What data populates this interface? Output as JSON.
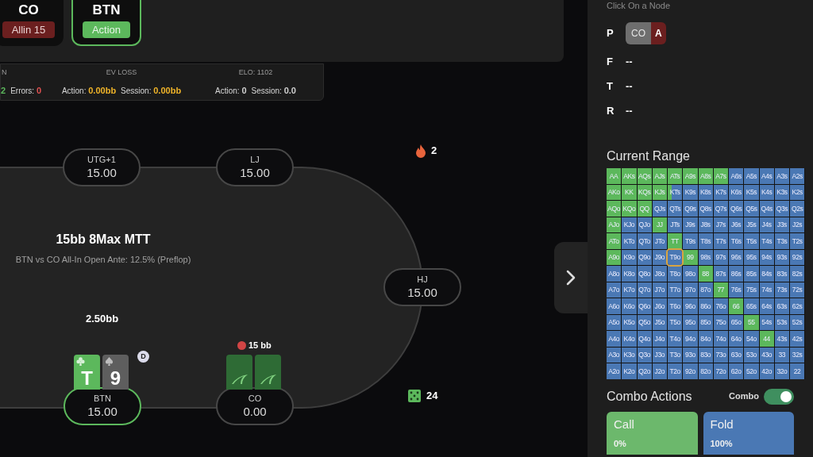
{
  "header_positions": [
    {
      "name": "CO",
      "badge": "Allin 15",
      "kind": "allin",
      "selected": false
    },
    {
      "name": "BTN",
      "badge": "Action",
      "kind": "action",
      "selected": true
    }
  ],
  "stats": [
    {
      "heading": "N",
      "items": [
        {
          "value": "2",
          "color": "#5cb85c"
        },
        {
          "label": "Errors:",
          "value": "0",
          "color": "#e05252"
        }
      ]
    },
    {
      "heading": "EV LOSS",
      "items": [
        {
          "label": "Action:",
          "value": "0.00bb",
          "color": "#f0b429"
        },
        {
          "label": "Session:",
          "value": "0.00bb",
          "color": "#f0b429"
        }
      ]
    },
    {
      "heading": "ELO: 1102",
      "items": [
        {
          "label": "Action:",
          "value": "0",
          "color": "#cfcfcf"
        },
        {
          "label": "Session:",
          "value": "0.0",
          "color": "#cfcfcf"
        }
      ]
    }
  ],
  "table": {
    "title": "15bb 8Max MTT",
    "subtitle": "BTN vs CO All-In Open Ante: 12.5% (Preflop)",
    "seats": [
      {
        "position": "UTG+1",
        "stack": "15.00",
        "active": false
      },
      {
        "position": "LJ",
        "stack": "15.00",
        "active": false
      },
      {
        "position": "HJ",
        "stack": "15.00",
        "active": false
      },
      {
        "position": "BTN",
        "stack": "15.00",
        "active": true,
        "bet": "2.50bb",
        "dealer": "D",
        "cards": [
          {
            "rank": "T",
            "kind": "clubs"
          },
          {
            "rank": "9",
            "kind": "spades"
          }
        ]
      },
      {
        "position": "CO",
        "stack": "0.00",
        "active": false,
        "allin": "15 bb",
        "cards": [
          {
            "kind": "back"
          },
          {
            "kind": "back"
          }
        ]
      }
    ],
    "streak": "2",
    "hands_count": "24"
  },
  "node_panel": {
    "hint": "Click On a Node",
    "streets": [
      {
        "label": "P",
        "actions": [
          {
            "seat": "CO",
            "action": "A"
          }
        ]
      },
      {
        "label": "F",
        "empty": "--"
      },
      {
        "label": "T",
        "empty": "--"
      },
      {
        "label": "R",
        "empty": "--"
      }
    ]
  },
  "range": {
    "title": "Current Range",
    "rows": [
      [
        {
          "hand": "AA",
          "kind": "call",
          "selected": false
        },
        {
          "hand": "AKs",
          "kind": "call",
          "selected": false
        },
        {
          "hand": "AQs",
          "kind": "call",
          "selected": false
        },
        {
          "hand": "AJs",
          "kind": "call",
          "selected": false
        },
        {
          "hand": "ATs",
          "kind": "call",
          "selected": false
        },
        {
          "hand": "A9s",
          "kind": "call",
          "selected": false
        },
        {
          "hand": "A8s",
          "kind": "call",
          "selected": false
        },
        {
          "hand": "A7s",
          "kind": "call",
          "selected": false
        },
        {
          "hand": "A6s",
          "kind": "fold",
          "selected": false
        },
        {
          "hand": "A5s",
          "kind": "fold",
          "selected": false
        },
        {
          "hand": "A4s",
          "kind": "fold",
          "selected": false
        },
        {
          "hand": "A3s",
          "kind": "fold",
          "selected": false
        },
        {
          "hand": "A2s",
          "kind": "fold",
          "selected": false
        }
      ],
      [
        {
          "hand": "AKo",
          "kind": "call",
          "selected": false
        },
        {
          "hand": "KK",
          "kind": "call",
          "selected": false
        },
        {
          "hand": "KQs",
          "kind": "call",
          "selected": false
        },
        {
          "hand": "KJs",
          "kind": "call",
          "selected": false
        },
        {
          "hand": "KTs",
          "kind": "mixed",
          "selected": false
        },
        {
          "hand": "K9s",
          "kind": "fold",
          "selected": false
        },
        {
          "hand": "K8s",
          "kind": "fold",
          "selected": false
        },
        {
          "hand": "K7s",
          "kind": "fold",
          "selected": false
        },
        {
          "hand": "K6s",
          "kind": "fold",
          "selected": false
        },
        {
          "hand": "K5s",
          "kind": "fold",
          "selected": false
        },
        {
          "hand": "K4s",
          "kind": "fold",
          "selected": false
        },
        {
          "hand": "K3s",
          "kind": "fold",
          "selected": false
        },
        {
          "hand": "K2s",
          "kind": "fold",
          "selected": false
        }
      ],
      [
        {
          "hand": "AQo",
          "kind": "call",
          "selected": false
        },
        {
          "hand": "KQo",
          "kind": "call",
          "selected": false
        },
        {
          "hand": "QQ",
          "kind": "call",
          "selected": false
        },
        {
          "hand": "QJs",
          "kind": "fold",
          "selected": false
        },
        {
          "hand": "QTs",
          "kind": "fold",
          "selected": false
        },
        {
          "hand": "Q9s",
          "kind": "fold",
          "selected": false
        },
        {
          "hand": "Q8s",
          "kind": "fold",
          "selected": false
        },
        {
          "hand": "Q7s",
          "kind": "fold",
          "selected": false
        },
        {
          "hand": "Q6s",
          "kind": "fold",
          "selected": false
        },
        {
          "hand": "Q5s",
          "kind": "fold",
          "selected": false
        },
        {
          "hand": "Q4s",
          "kind": "fold",
          "selected": false
        },
        {
          "hand": "Q3s",
          "kind": "fold",
          "selected": false
        },
        {
          "hand": "Q2s",
          "kind": "fold",
          "selected": false
        }
      ],
      [
        {
          "hand": "AJo",
          "kind": "call",
          "selected": false
        },
        {
          "hand": "KJo",
          "kind": "fold",
          "selected": false
        },
        {
          "hand": "QJo",
          "kind": "fold",
          "selected": false
        },
        {
          "hand": "JJ",
          "kind": "call",
          "selected": false
        },
        {
          "hand": "JTs",
          "kind": "fold",
          "selected": false
        },
        {
          "hand": "J9s",
          "kind": "fold",
          "selected": false
        },
        {
          "hand": "J8s",
          "kind": "fold",
          "selected": false
        },
        {
          "hand": "J7s",
          "kind": "fold",
          "selected": false
        },
        {
          "hand": "J6s",
          "kind": "fold",
          "selected": false
        },
        {
          "hand": "J5s",
          "kind": "fold",
          "selected": false
        },
        {
          "hand": "J4s",
          "kind": "fold",
          "selected": false
        },
        {
          "hand": "J3s",
          "kind": "fold",
          "selected": false
        },
        {
          "hand": "J2s",
          "kind": "fold",
          "selected": false
        }
      ],
      [
        {
          "hand": "ATo",
          "kind": "call",
          "selected": false
        },
        {
          "hand": "KTo",
          "kind": "fold",
          "selected": false
        },
        {
          "hand": "QTo",
          "kind": "fold",
          "selected": false
        },
        {
          "hand": "JTo",
          "kind": "fold",
          "selected": false
        },
        {
          "hand": "TT",
          "kind": "call",
          "selected": false
        },
        {
          "hand": "T9s",
          "kind": "fold",
          "selected": false
        },
        {
          "hand": "T8s",
          "kind": "fold",
          "selected": false
        },
        {
          "hand": "T7s",
          "kind": "fold",
          "selected": false
        },
        {
          "hand": "T6s",
          "kind": "fold",
          "selected": false
        },
        {
          "hand": "T5s",
          "kind": "fold",
          "selected": false
        },
        {
          "hand": "T4s",
          "kind": "fold",
          "selected": false
        },
        {
          "hand": "T3s",
          "kind": "fold",
          "selected": false
        },
        {
          "hand": "T2s",
          "kind": "fold",
          "selected": false
        }
      ],
      [
        {
          "hand": "A9o",
          "kind": "call",
          "selected": false
        },
        {
          "hand": "K9o",
          "kind": "fold",
          "selected": false
        },
        {
          "hand": "Q9o",
          "kind": "fold",
          "selected": false
        },
        {
          "hand": "J9o",
          "kind": "fold",
          "selected": false
        },
        {
          "hand": "T9o",
          "kind": "fold",
          "selected": true
        },
        {
          "hand": "99",
          "kind": "call",
          "selected": false
        },
        {
          "hand": "98s",
          "kind": "fold",
          "selected": false
        },
        {
          "hand": "97s",
          "kind": "fold",
          "selected": false
        },
        {
          "hand": "96s",
          "kind": "fold",
          "selected": false
        },
        {
          "hand": "95s",
          "kind": "fold",
          "selected": false
        },
        {
          "hand": "94s",
          "kind": "fold",
          "selected": false
        },
        {
          "hand": "93s",
          "kind": "fold",
          "selected": false
        },
        {
          "hand": "92s",
          "kind": "fold",
          "selected": false
        }
      ],
      [
        {
          "hand": "A8o",
          "kind": "fold",
          "selected": false
        },
        {
          "hand": "K8o",
          "kind": "fold",
          "selected": false
        },
        {
          "hand": "Q8o",
          "kind": "fold",
          "selected": false
        },
        {
          "hand": "J8o",
          "kind": "fold",
          "selected": false
        },
        {
          "hand": "T8o",
          "kind": "fold",
          "selected": false
        },
        {
          "hand": "98o",
          "kind": "fold",
          "selected": false
        },
        {
          "hand": "88",
          "kind": "call",
          "selected": false
        },
        {
          "hand": "87s",
          "kind": "fold",
          "selected": false
        },
        {
          "hand": "86s",
          "kind": "fold",
          "selected": false
        },
        {
          "hand": "85s",
          "kind": "fold",
          "selected": false
        },
        {
          "hand": "84s",
          "kind": "fold",
          "selected": false
        },
        {
          "hand": "83s",
          "kind": "fold",
          "selected": false
        },
        {
          "hand": "82s",
          "kind": "fold",
          "selected": false
        }
      ],
      [
        {
          "hand": "A7o",
          "kind": "fold",
          "selected": false
        },
        {
          "hand": "K7o",
          "kind": "fold",
          "selected": false
        },
        {
          "hand": "Q7o",
          "kind": "fold",
          "selected": false
        },
        {
          "hand": "J7o",
          "kind": "fold",
          "selected": false
        },
        {
          "hand": "T7o",
          "kind": "fold",
          "selected": false
        },
        {
          "hand": "97o",
          "kind": "fold",
          "selected": false
        },
        {
          "hand": "87o",
          "kind": "fold",
          "selected": false
        },
        {
          "hand": "77",
          "kind": "call",
          "selected": false
        },
        {
          "hand": "76s",
          "kind": "fold",
          "selected": false
        },
        {
          "hand": "75s",
          "kind": "fold",
          "selected": false
        },
        {
          "hand": "74s",
          "kind": "fold",
          "selected": false
        },
        {
          "hand": "73s",
          "kind": "fold",
          "selected": false
        },
        {
          "hand": "72s",
          "kind": "fold",
          "selected": false
        }
      ],
      [
        {
          "hand": "A6o",
          "kind": "fold",
          "selected": false
        },
        {
          "hand": "K6o",
          "kind": "fold",
          "selected": false
        },
        {
          "hand": "Q6o",
          "kind": "fold",
          "selected": false
        },
        {
          "hand": "J6o",
          "kind": "fold",
          "selected": false
        },
        {
          "hand": "T6o",
          "kind": "fold",
          "selected": false
        },
        {
          "hand": "96o",
          "kind": "fold",
          "selected": false
        },
        {
          "hand": "86o",
          "kind": "fold",
          "selected": false
        },
        {
          "hand": "76o",
          "kind": "fold",
          "selected": false
        },
        {
          "hand": "66",
          "kind": "call",
          "selected": false
        },
        {
          "hand": "65s",
          "kind": "fold",
          "selected": false
        },
        {
          "hand": "64s",
          "kind": "fold",
          "selected": false
        },
        {
          "hand": "63s",
          "kind": "fold",
          "selected": false
        },
        {
          "hand": "62s",
          "kind": "fold",
          "selected": false
        }
      ],
      [
        {
          "hand": "A5o",
          "kind": "fold",
          "selected": false
        },
        {
          "hand": "K5o",
          "kind": "fold",
          "selected": false
        },
        {
          "hand": "Q5o",
          "kind": "fold",
          "selected": false
        },
        {
          "hand": "J5o",
          "kind": "fold",
          "selected": false
        },
        {
          "hand": "T5o",
          "kind": "fold",
          "selected": false
        },
        {
          "hand": "95o",
          "kind": "fold",
          "selected": false
        },
        {
          "hand": "85o",
          "kind": "fold",
          "selected": false
        },
        {
          "hand": "75o",
          "kind": "fold",
          "selected": false
        },
        {
          "hand": "65o",
          "kind": "fold",
          "selected": false
        },
        {
          "hand": "55",
          "kind": "call",
          "selected": false
        },
        {
          "hand": "54s",
          "kind": "fold",
          "selected": false
        },
        {
          "hand": "53s",
          "kind": "fold",
          "selected": false
        },
        {
          "hand": "52s",
          "kind": "fold",
          "selected": false
        }
      ],
      [
        {
          "hand": "A4o",
          "kind": "fold",
          "selected": false
        },
        {
          "hand": "K4o",
          "kind": "fold",
          "selected": false
        },
        {
          "hand": "Q4o",
          "kind": "fold",
          "selected": false
        },
        {
          "hand": "J4o",
          "kind": "fold",
          "selected": false
        },
        {
          "hand": "T4o",
          "kind": "fold",
          "selected": false
        },
        {
          "hand": "94o",
          "kind": "fold",
          "selected": false
        },
        {
          "hand": "84o",
          "kind": "fold",
          "selected": false
        },
        {
          "hand": "74o",
          "kind": "fold",
          "selected": false
        },
        {
          "hand": "64o",
          "kind": "fold",
          "selected": false
        },
        {
          "hand": "54o",
          "kind": "fold",
          "selected": false
        },
        {
          "hand": "44",
          "kind": "call",
          "selected": false
        },
        {
          "hand": "43s",
          "kind": "fold",
          "selected": false
        },
        {
          "hand": "42s",
          "kind": "fold",
          "selected": false
        }
      ],
      [
        {
          "hand": "A3o",
          "kind": "fold",
          "selected": false
        },
        {
          "hand": "K3o",
          "kind": "fold",
          "selected": false
        },
        {
          "hand": "Q3o",
          "kind": "fold",
          "selected": false
        },
        {
          "hand": "J3o",
          "kind": "fold",
          "selected": false
        },
        {
          "hand": "T3o",
          "kind": "fold",
          "selected": false
        },
        {
          "hand": "93o",
          "kind": "fold",
          "selected": false
        },
        {
          "hand": "83o",
          "kind": "fold",
          "selected": false
        },
        {
          "hand": "73o",
          "kind": "fold",
          "selected": false
        },
        {
          "hand": "63o",
          "kind": "fold",
          "selected": false
        },
        {
          "hand": "53o",
          "kind": "fold",
          "selected": false
        },
        {
          "hand": "43o",
          "kind": "fold",
          "selected": false
        },
        {
          "hand": "33",
          "kind": "fold",
          "selected": false
        },
        {
          "hand": "32s",
          "kind": "fold",
          "selected": false
        }
      ],
      [
        {
          "hand": "A2o",
          "kind": "fold",
          "selected": false
        },
        {
          "hand": "K2o",
          "kind": "fold",
          "selected": false
        },
        {
          "hand": "Q2o",
          "kind": "fold",
          "selected": false
        },
        {
          "hand": "J2o",
          "kind": "fold",
          "selected": false
        },
        {
          "hand": "T2o",
          "kind": "fold",
          "selected": false
        },
        {
          "hand": "92o",
          "kind": "fold",
          "selected": false
        },
        {
          "hand": "82o",
          "kind": "fold",
          "selected": false
        },
        {
          "hand": "72o",
          "kind": "fold",
          "selected": false
        },
        {
          "hand": "62o",
          "kind": "fold",
          "selected": false
        },
        {
          "hand": "52o",
          "kind": "fold",
          "selected": false
        },
        {
          "hand": "42o",
          "kind": "fold",
          "selected": false
        },
        {
          "hand": "32o",
          "kind": "fold",
          "selected": false
        },
        {
          "hand": "22",
          "kind": "fold",
          "selected": false
        }
      ]
    ]
  },
  "combo_actions": {
    "title": "Combo Actions",
    "toggle": {
      "label": "Combo",
      "on": true
    },
    "actions": [
      {
        "name": "Call",
        "share": "0%",
        "kind": "call"
      },
      {
        "name": "Fold",
        "share": "100%",
        "kind": "fold"
      }
    ]
  }
}
